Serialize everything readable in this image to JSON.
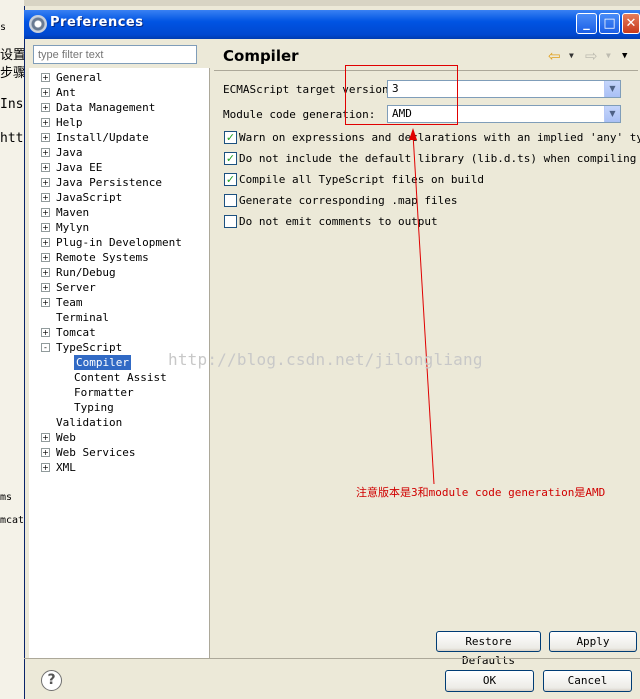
{
  "window": {
    "title": "Preferences",
    "controls": {
      "minimize": "_",
      "maximize": "□",
      "close": "✕"
    }
  },
  "background_app": {
    "text_fragments": [
      "s",
      "设置",
      "步骤",
      "Ins",
      "htt",
      "ms",
      "mcat"
    ]
  },
  "filter": {
    "placeholder": "type filter text"
  },
  "tree": {
    "items": [
      {
        "label": "General",
        "expander": "+"
      },
      {
        "label": "Ant",
        "expander": "+"
      },
      {
        "label": "Data Management",
        "expander": "+"
      },
      {
        "label": "Help",
        "expander": "+"
      },
      {
        "label": "Install/Update",
        "expander": "+"
      },
      {
        "label": "Java",
        "expander": "+"
      },
      {
        "label": "Java EE",
        "expander": "+"
      },
      {
        "label": "Java Persistence",
        "expander": "+"
      },
      {
        "label": "JavaScript",
        "expander": "+"
      },
      {
        "label": "Maven",
        "expander": "+"
      },
      {
        "label": "Mylyn",
        "expander": "+"
      },
      {
        "label": "Plug-in Development",
        "expander": "+"
      },
      {
        "label": "Remote Systems",
        "expander": "+"
      },
      {
        "label": "Run/Debug",
        "expander": "+"
      },
      {
        "label": "Server",
        "expander": "+"
      },
      {
        "label": "Team",
        "expander": "+"
      },
      {
        "label": "Terminal",
        "expander": ""
      },
      {
        "label": "Tomcat",
        "expander": "+"
      },
      {
        "label": "TypeScript",
        "expander": "-"
      },
      {
        "label": "Compiler",
        "expander": "",
        "child": true,
        "selected": true
      },
      {
        "label": "Content Assist",
        "expander": "",
        "child": true
      },
      {
        "label": "Formatter",
        "expander": "",
        "child": true
      },
      {
        "label": "Typing",
        "expander": "",
        "child": true
      },
      {
        "label": "Validation",
        "expander": ""
      },
      {
        "label": "Web",
        "expander": "+"
      },
      {
        "label": "Web Services",
        "expander": "+"
      },
      {
        "label": "XML",
        "expander": "+"
      }
    ]
  },
  "page": {
    "title": "Compiler",
    "nav": {
      "back": "⇦",
      "forward": "⇨",
      "dropdown": "▼",
      "menu": "▼"
    },
    "target_version": {
      "label": "ECMAScript target version:",
      "value": "3"
    },
    "module_generation": {
      "label": "Module code generation:",
      "value": "AMD"
    },
    "combo_arrow": "▼",
    "checkboxes": [
      {
        "label": "Warn on expressions and declarations with an implied 'any' type",
        "checked": true
      },
      {
        "label": "Do not include the default library (lib.d.ts) when compiling",
        "checked": true
      },
      {
        "label": "Compile all TypeScript files on build",
        "checked": true
      },
      {
        "label": "Generate corresponding .map files",
        "checked": false
      },
      {
        "label": "Do not emit comments to output",
        "checked": false
      }
    ],
    "restore_defaults": "Restore Defaults",
    "apply": "Apply"
  },
  "annotation": {
    "watermark": "http://blog.csdn.net/jilongliang",
    "note": "注意版本是3和module code generation是AMD",
    "color": "#e00000"
  },
  "footer": {
    "help": "?",
    "ok": "OK",
    "cancel": "Cancel"
  }
}
